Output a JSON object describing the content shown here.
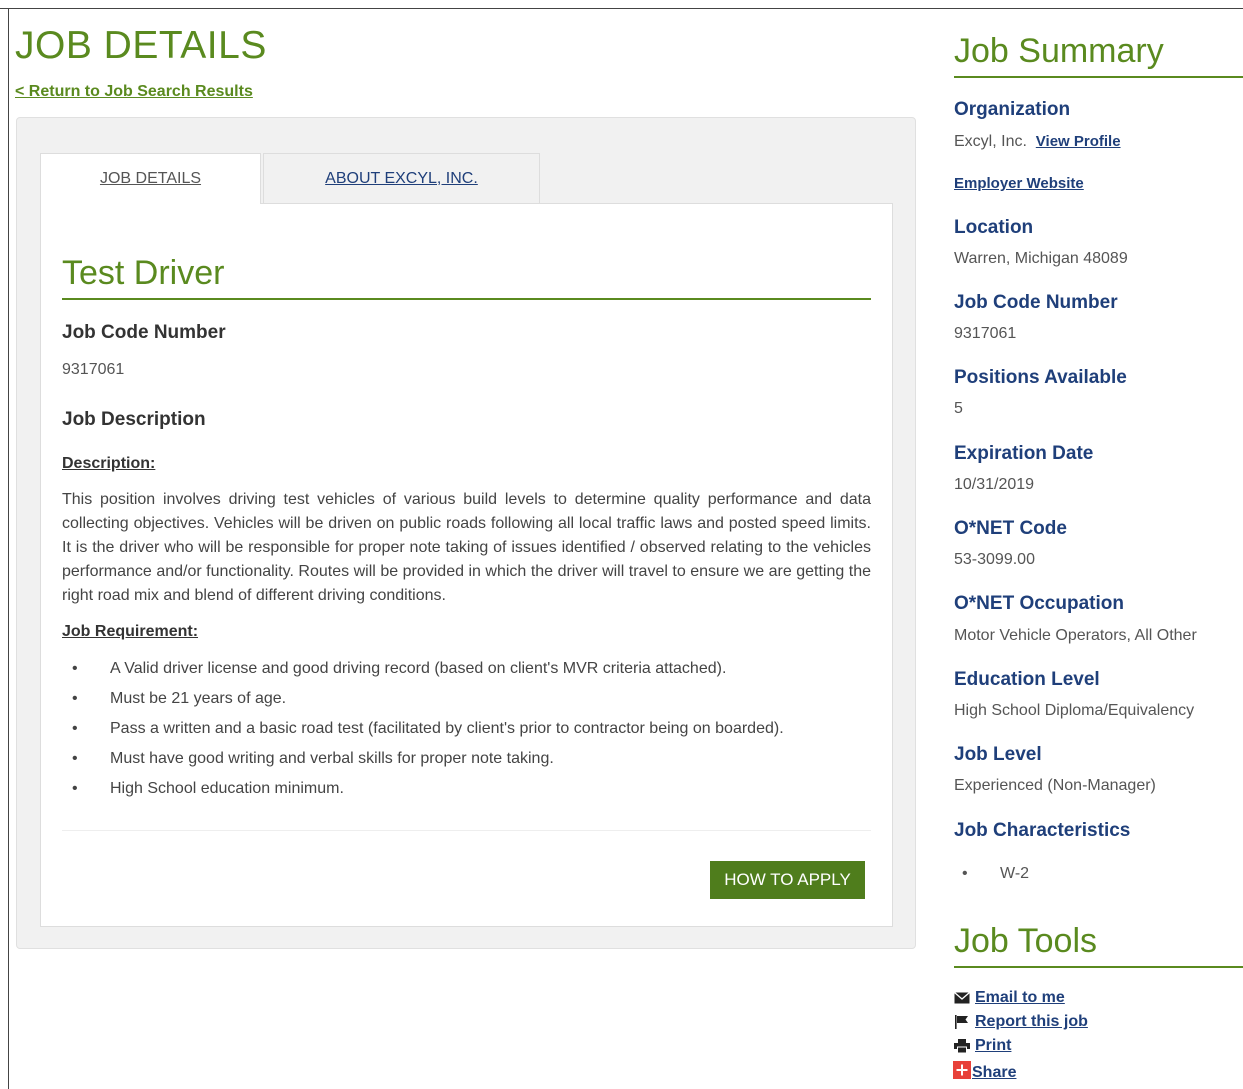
{
  "page": {
    "title": "JOB DETAILS",
    "back_link": "< Return to Job Search Results"
  },
  "tabs": [
    {
      "label": "JOB DETAILS",
      "active": true
    },
    {
      "label": "ABOUT EXCYL, INC.",
      "active": false
    }
  ],
  "job": {
    "title": "Test Driver",
    "code_label": "Job Code Number",
    "code": "9317061",
    "description_heading": "Job Description",
    "description_label": "Description:",
    "description": "This position involves driving test vehicles of various build levels to determine quality performance and data collecting objectives. Vehicles will be driven on public roads following all local traffic laws and posted speed limits. It is the driver who will be responsible for proper note taking of issues identified / observed relating to the vehicles performance and/or functionality. Routes will be provided in which the driver will travel to ensure we are getting the right road mix and blend of different driving conditions.",
    "requirement_label": "Job Requirement:",
    "requirements": [
      "A Valid driver license and good driving record (based on client's MVR criteria attached).",
      "Must be 21 years of age.",
      "Pass a written and a basic road test (facilitated by client's prior to contractor being on boarded).",
      "Must have good writing and verbal skills for proper note taking.",
      "High School education minimum."
    ],
    "apply_label": "HOW TO APPLY"
  },
  "summary": {
    "title": "Job Summary",
    "organization_label": "Organization",
    "organization": "Excyl, Inc.",
    "view_profile": "View Profile",
    "employer_website": "Employer Website",
    "location_label": "Location",
    "location": "Warren, Michigan 48089",
    "code_label": "Job Code Number",
    "code": "9317061",
    "positions_label": "Positions Available",
    "positions": "5",
    "expiration_label": "Expiration Date",
    "expiration": "10/31/2019",
    "onet_code_label": "O*NET Code",
    "onet_code": "53-3099.00",
    "onet_occ_label": "O*NET Occupation",
    "onet_occ": "Motor Vehicle Operators, All Other",
    "education_label": "Education Level",
    "education": "High School Diploma/Equivalency",
    "level_label": "Job Level",
    "level": "Experienced (Non-Manager)",
    "characteristics_label": "Job Characteristics",
    "characteristics": [
      "W-2"
    ]
  },
  "tools": {
    "title": "Job Tools",
    "items": [
      {
        "label": "Email to me",
        "icon": "envelope-icon"
      },
      {
        "label": "Report this job",
        "icon": "flag-icon"
      },
      {
        "label": "Print",
        "icon": "printer-icon"
      },
      {
        "label": "Share",
        "icon": "plus-share-icon"
      }
    ]
  },
  "colors": {
    "brand_green": "#5a8a1f",
    "button_green": "#4f7d1c",
    "link_blue": "#1f3f7a"
  }
}
